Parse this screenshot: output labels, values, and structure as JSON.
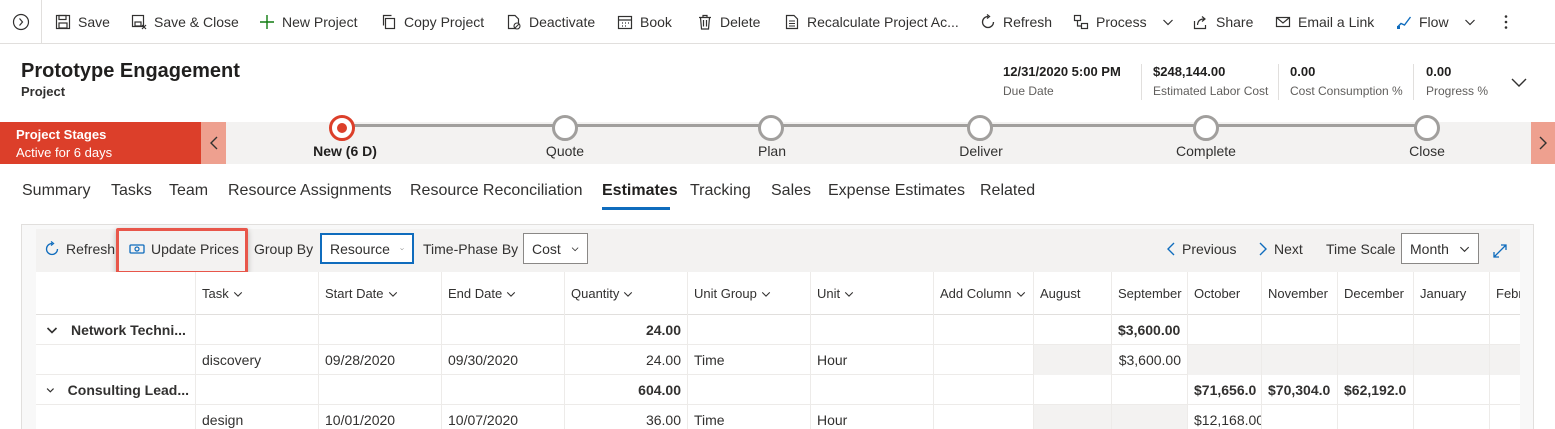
{
  "toolbar": {
    "save": "Save",
    "save_close": "Save & Close",
    "new_project": "New Project",
    "copy_project": "Copy Project",
    "deactivate": "Deactivate",
    "book": "Book",
    "delete": "Delete",
    "recalculate": "Recalculate Project Ac...",
    "refresh": "Refresh",
    "process": "Process",
    "share": "Share",
    "email_link": "Email a Link",
    "flow": "Flow"
  },
  "header": {
    "title": "Prototype Engagement",
    "entity": "Project",
    "fields": [
      {
        "value": "12/31/2020 5:00 PM",
        "label": "Due Date"
      },
      {
        "value": "$248,144.00",
        "label": "Estimated Labor Cost"
      },
      {
        "value": "0.00",
        "label": "Cost Consumption %"
      },
      {
        "value": "0.00",
        "label": "Progress %"
      }
    ]
  },
  "bpf": {
    "name": "Project Stages",
    "status": "Active for 6 days",
    "stages": [
      {
        "label": "New  (6 D)",
        "active": true
      },
      {
        "label": "Quote"
      },
      {
        "label": "Plan"
      },
      {
        "label": "Deliver"
      },
      {
        "label": "Complete"
      },
      {
        "label": "Close"
      }
    ]
  },
  "tabs": [
    "Summary",
    "Tasks",
    "Team",
    "Resource Assignments",
    "Resource Reconciliation",
    "Estimates",
    "Tracking",
    "Sales",
    "Expense Estimates",
    "Related"
  ],
  "active_tab": "Estimates",
  "grid_toolbar": {
    "refresh": "Refresh",
    "update_prices": "Update Prices",
    "group_by_label": "Group By",
    "group_by_value": "Resource",
    "time_phase_label": "Time-Phase By",
    "time_phase_value": "Cost",
    "previous": "Previous",
    "next": "Next",
    "time_scale_label": "Time Scale",
    "time_scale_value": "Month"
  },
  "grid": {
    "columns": [
      "Task",
      "Start Date",
      "End Date",
      "Quantity",
      "Unit Group",
      "Unit",
      "Add Column",
      "August",
      "September",
      "October",
      "November",
      "December",
      "January",
      "Febr"
    ],
    "rows": [
      {
        "type": "group",
        "name": "Network Techni...",
        "quantity": "24.00",
        "september": "$3,600.00"
      },
      {
        "type": "item",
        "task": "discovery",
        "start": "09/28/2020",
        "end": "09/30/2020",
        "quantity": "24.00",
        "unit_group": "Time",
        "unit": "Hour",
        "september": "$3,600.00"
      },
      {
        "type": "group",
        "name": "Consulting Lead...",
        "quantity": "604.00",
        "october": "$71,656.0",
        "november": "$70,304.0",
        "december": "$62,192.0"
      },
      {
        "type": "item",
        "task": "design",
        "start": "10/01/2020",
        "end": "10/07/2020",
        "quantity": "36.00",
        "unit_group": "Time",
        "unit": "Hour",
        "october": "$12,168.00"
      }
    ]
  }
}
